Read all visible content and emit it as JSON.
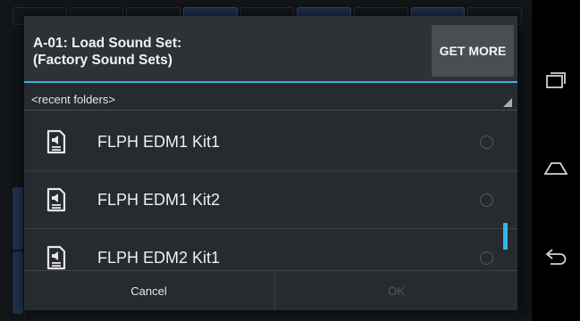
{
  "dialog": {
    "title_line1": "A-01: Load Sound Set:",
    "title_line2": "(Factory Sound Sets)",
    "get_more_label": "GET MORE",
    "folder_selector": "<recent folders>",
    "items": [
      {
        "label": "FLPH EDM1 Kit1",
        "icon": "sound-file-icon",
        "selected": false
      },
      {
        "label": "FLPH EDM1 Kit2",
        "icon": "sound-file-icon",
        "selected": false
      },
      {
        "label": "FLPH EDM2 Kit1",
        "icon": "sound-file-icon",
        "selected": false
      }
    ],
    "cancel_label": "Cancel",
    "ok_label": "OK"
  },
  "navbar": {
    "icons": [
      "recent-apps-icon",
      "home-icon",
      "back-icon"
    ]
  },
  "colors": {
    "accent": "#33b5e5",
    "dialog_bg": "#272a2e",
    "navbar_bg": "#000000"
  }
}
